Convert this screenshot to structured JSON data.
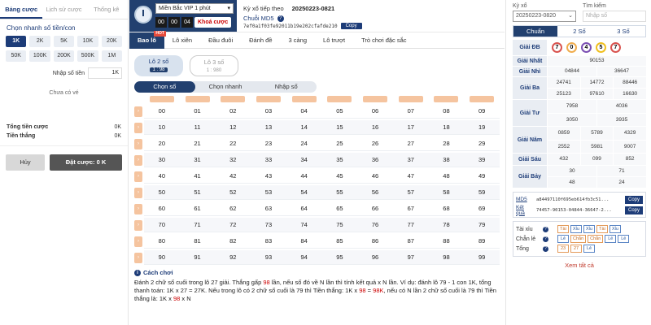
{
  "left": {
    "tabs": [
      "Bảng cược",
      "Lịch sử cược",
      "Thống kê"
    ],
    "quick_title": "Chọn nhanh số tiền/con",
    "chips": [
      "1K",
      "2K",
      "5K",
      "10K",
      "20K",
      "50K",
      "100K",
      "200K",
      "500K",
      "1M"
    ],
    "input_label": "Nhập số tiền",
    "input_value": "1K",
    "empty_text": "Chưa có vé",
    "total_label": "Tổng tiền cược",
    "total_value": "0K",
    "win_label": "Tiền thắng",
    "win_value": "0K",
    "cancel": "Hủy",
    "place": "Đặt cược: 0 K"
  },
  "top": {
    "game": "Miền Bắc VIP 1 phút",
    "timer": [
      "00",
      "00",
      "04"
    ],
    "lock": "Khoá cược",
    "ky_label": "Kỳ xổ tiếp theo",
    "ky_value": "20250223-0821",
    "md5_label": "Chuỗi MD5",
    "md5_hash": "7ef0a1f03fe92011b19e202cfafde210",
    "copy": "Copy"
  },
  "bet_tabs": [
    "Bao lô",
    "Lô xiên",
    "Đầu đuôi",
    "Đánh đề",
    "3 càng",
    "Lô trượt",
    "Trò chơi đặc sắc"
  ],
  "hot": "HOT",
  "lo": [
    {
      "name": "Lô 2 số",
      "rate": "1 : 98"
    },
    {
      "name": "Lô 3 số",
      "rate": "1 : 980"
    }
  ],
  "modes": [
    "Chọn số",
    "Chọn nhanh",
    "Nhập số"
  ],
  "grid_rows": [
    [
      "00",
      "01",
      "02",
      "03",
      "04",
      "05",
      "06",
      "07",
      "08",
      "09"
    ],
    [
      "10",
      "11",
      "12",
      "13",
      "14",
      "15",
      "16",
      "17",
      "18",
      "19"
    ],
    [
      "20",
      "21",
      "22",
      "23",
      "24",
      "25",
      "26",
      "27",
      "28",
      "29"
    ],
    [
      "30",
      "31",
      "32",
      "33",
      "34",
      "35",
      "36",
      "37",
      "38",
      "39"
    ],
    [
      "40",
      "41",
      "42",
      "43",
      "44",
      "45",
      "46",
      "47",
      "48",
      "49"
    ],
    [
      "50",
      "51",
      "52",
      "53",
      "54",
      "55",
      "56",
      "57",
      "58",
      "59"
    ],
    [
      "60",
      "61",
      "62",
      "63",
      "64",
      "65",
      "66",
      "67",
      "68",
      "69"
    ],
    [
      "70",
      "71",
      "72",
      "73",
      "74",
      "75",
      "76",
      "77",
      "78",
      "79"
    ],
    [
      "80",
      "81",
      "82",
      "83",
      "84",
      "85",
      "86",
      "87",
      "88",
      "89"
    ],
    [
      "90",
      "91",
      "92",
      "93",
      "94",
      "95",
      "96",
      "97",
      "98",
      "99"
    ]
  ],
  "howto": {
    "title": "Cách chơi",
    "p1": "Đánh 2 chữ số cuối trong lô 27 giải. Thắng gấp ",
    "p1_red": "98",
    "p2": " lần, nếu số đó về N lần thì tính kết quả x N lần. Ví dụ: đánh lô 79 - 1 con 1K, tổng thanh toán: 1K x 27 = 27K. Nếu trong lô có 2 chữ số cuối là 79 thì Tiền thắng: 1K x ",
    "p2_red": "98",
    "p3": " = ",
    "p3_red": "98K",
    "p4": ", nếu có N lần 2 chữ số cuối là 79 thì Tiền thắng là: 1K x ",
    "p4_red": "98",
    "p5": " x N"
  },
  "right": {
    "ky_label": "Kỳ xổ",
    "ky_value": "20250223-0820",
    "search_label": "Tìm kiếm",
    "search_placeholder": "Nhập số",
    "tabs": [
      "Chuẩn",
      "2 Số",
      "3 Số"
    ],
    "balls": [
      {
        "n": "7",
        "color": "#d9534f"
      },
      {
        "n": "0",
        "color": "#f0ad4e"
      },
      {
        "n": "4",
        "color": "#7b4fb3"
      },
      {
        "n": "5",
        "color": "#f0c020"
      },
      {
        "n": "7",
        "color": "#d9534f"
      }
    ],
    "prizes": [
      {
        "label": "Giải ĐB",
        "values": []
      },
      {
        "label": "Giải Nhất",
        "values": [
          "90153"
        ]
      },
      {
        "label": "Giải Nhì",
        "values": [
          "04844",
          "36647"
        ]
      },
      {
        "label": "Giải Ba",
        "values": [
          "24741",
          "14772",
          "88446",
          "25123",
          "97610",
          "16630"
        ]
      },
      {
        "label": "Giải Tư",
        "values": [
          "7958",
          "4036",
          "3050",
          "3935"
        ]
      },
      {
        "label": "Giải Năm",
        "values": [
          "0859",
          "5789",
          "4329",
          "2552",
          "5981",
          "9007"
        ]
      },
      {
        "label": "Giải Sáu",
        "values": [
          "432",
          "099",
          "852"
        ]
      },
      {
        "label": "Giải Bảy",
        "values": [
          "30",
          "71",
          "48",
          "24"
        ]
      }
    ],
    "md5_k": "MD5",
    "md5_v": "a84497110f695eb614fb3c51...",
    "kq_k": "Kết quả",
    "kq_v": "74457-90153-04844-36647-2...",
    "copy": "Copy",
    "stats": [
      {
        "label": "Tài xỉu",
        "items": [
          [
            "Tài",
            "o"
          ],
          [
            "Xỉu",
            "b"
          ],
          [
            "Xỉu",
            "b"
          ],
          [
            "Tài",
            "o"
          ],
          [
            "Xỉu",
            "b"
          ]
        ]
      },
      {
        "label": "Chẵn lẻ",
        "items": [
          [
            "Lẻ",
            "b"
          ],
          [
            "Chẵn",
            "o"
          ],
          [
            "Chẵn",
            "o"
          ],
          [
            "Lẻ",
            "b"
          ],
          [
            "Lẻ",
            "b"
          ]
        ]
      },
      {
        "label": "Tổng",
        "items": [
          [
            "23",
            "o"
          ],
          [
            "27",
            "o"
          ],
          [
            "Lẻ",
            "b"
          ]
        ]
      }
    ],
    "see_all": "Xem tất cả"
  }
}
